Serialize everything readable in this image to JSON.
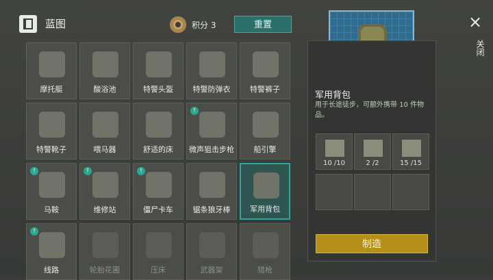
{
  "header": {
    "title": "蓝图",
    "points_label": "积分 3",
    "reset_label": "重置"
  },
  "close": {
    "icon": "close-icon",
    "label": "关闭"
  },
  "grid_items": [
    {
      "label": "摩托艇",
      "alert": false,
      "dim": false,
      "selected": false,
      "icon": "boat-icon"
    },
    {
      "label": "酸浴池",
      "alert": false,
      "dim": false,
      "selected": false,
      "icon": "tub-icon"
    },
    {
      "label": "特警头盔",
      "alert": false,
      "dim": false,
      "selected": false,
      "icon": "helmet-icon"
    },
    {
      "label": "特警防弹衣",
      "alert": false,
      "dim": false,
      "selected": false,
      "icon": "vest-icon"
    },
    {
      "label": "特警裤子",
      "alert": false,
      "dim": false,
      "selected": false,
      "icon": "pants-icon"
    },
    {
      "label": "特警靴子",
      "alert": false,
      "dim": false,
      "selected": false,
      "icon": "boots-icon"
    },
    {
      "label": "喂马器",
      "alert": false,
      "dim": false,
      "selected": false,
      "icon": "feeder-icon"
    },
    {
      "label": "舒适的床",
      "alert": false,
      "dim": false,
      "selected": false,
      "icon": "bed-icon"
    },
    {
      "label": "微声狙击步枪",
      "alert": true,
      "dim": false,
      "selected": false,
      "icon": "rifle-icon"
    },
    {
      "label": "船引擎",
      "alert": false,
      "dim": false,
      "selected": false,
      "icon": "engine-icon"
    },
    {
      "label": "马鞍",
      "alert": true,
      "dim": false,
      "selected": false,
      "icon": "saddle-icon"
    },
    {
      "label": "维修站",
      "alert": true,
      "dim": false,
      "selected": false,
      "icon": "repair-icon"
    },
    {
      "label": "僵尸卡车",
      "alert": true,
      "dim": false,
      "selected": false,
      "icon": "truck-icon"
    },
    {
      "label": "锯条狼牙棒",
      "alert": false,
      "dim": false,
      "selected": false,
      "icon": "mace-icon"
    },
    {
      "label": "军用背包",
      "alert": false,
      "dim": false,
      "selected": true,
      "icon": "backpack-icon"
    },
    {
      "label": "线路",
      "alert": true,
      "dim": false,
      "selected": false,
      "icon": "wire-icon"
    },
    {
      "label": "轮胎花圃",
      "alert": false,
      "dim": true,
      "selected": false,
      "icon": "planter-icon"
    },
    {
      "label": "压床",
      "alert": false,
      "dim": true,
      "selected": false,
      "icon": "press-icon"
    },
    {
      "label": "武器架",
      "alert": false,
      "dim": true,
      "selected": false,
      "icon": "rack-icon"
    },
    {
      "label": "猎枪",
      "alert": false,
      "dim": true,
      "selected": false,
      "icon": "shotgun-icon"
    }
  ],
  "details": {
    "name": "军用背包",
    "description": "用于长途徒步，可额外携带 10 件物品。",
    "craft_label": "制造",
    "materials": [
      {
        "count": "10",
        "max": "/10",
        "icon": "cloth-icon"
      },
      {
        "count": "2",
        "max": "/2",
        "icon": "glass-icon"
      },
      {
        "count": "15",
        "max": "/15",
        "icon": "rope-icon"
      }
    ]
  }
}
